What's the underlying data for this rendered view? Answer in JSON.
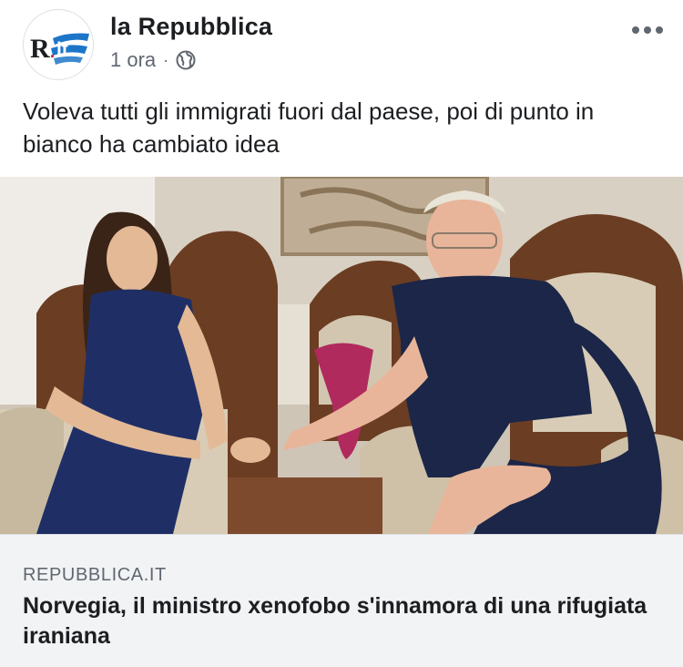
{
  "post": {
    "page_name": "la Repubblica",
    "avatar_text": "R.it",
    "timestamp": "1 ora",
    "separator": "·",
    "audience_icon": "globe-icon",
    "more_icon": "more-options-icon",
    "text": "Voleva tutti gli immigrati fuori dal paese, poi di punto in bianco ha cambiato idea"
  },
  "link_preview": {
    "domain": "REPUBBLICA.IT",
    "headline": "Norvegia, il ministro xenofobo s'innamora di una rifugiata iraniana"
  },
  "colors": {
    "primary_text": "#1c1e21",
    "secondary_text": "#606770",
    "link_background": "#f2f3f5",
    "logo_red": "#c8102e",
    "logo_blue": "#1d75c8"
  }
}
